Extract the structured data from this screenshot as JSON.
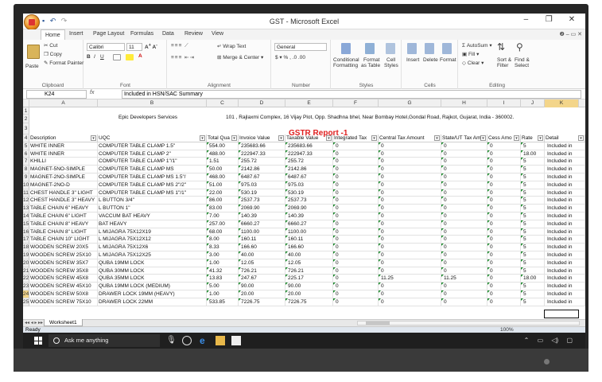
{
  "window": {
    "title": "GST - Microsoft Excel",
    "controls": [
      "–",
      "❐",
      "✕"
    ]
  },
  "ribbon": {
    "tabs": [
      "Home",
      "Insert",
      "Page Layout",
      "Formulas",
      "Data",
      "Review",
      "View"
    ],
    "help": "❷ – ▭ ✕",
    "clipboard": {
      "paste": "Paste",
      "cut": "Cut",
      "copy": "Copy",
      "format_painter": "Format Painter",
      "label": "Clipboard"
    },
    "font": {
      "name": "Calibri",
      "size": "11",
      "label": "Font"
    },
    "alignment": {
      "wrap": "Wrap Text",
      "merge": "Merge & Center",
      "label": "Alignment"
    },
    "number": {
      "format": "General",
      "label": "Number"
    },
    "styles": {
      "conditional": "Conditional",
      "conditional2": "Formatting",
      "format_table": "Format",
      "format_table2": "as Table",
      "cell_styles": "Cell",
      "cell_styles2": "Styles",
      "label": "Styles"
    },
    "cells": {
      "insert": "Insert",
      "delete": "Delete",
      "format": "Format",
      "label": "Cells"
    },
    "editing": {
      "autosum": "AutoSum",
      "fill": "Fill",
      "clear": "Clear",
      "sort": "Sort &",
      "sort2": "Filter",
      "find": "Find &",
      "find2": "Select",
      "label": "Editing"
    }
  },
  "formula_bar": {
    "name_box": "K24",
    "fx": "fx",
    "formula": "Included in HSN/SAC Summary"
  },
  "columns": [
    "A",
    "B",
    "C",
    "D",
    "E",
    "F",
    "G",
    "H",
    "I",
    "J",
    "K"
  ],
  "sheet": {
    "company": "Epic Developers Services",
    "address": "101 , Rajlaxmi Complex, 16 Vijay Plot, Opp. Shadhna bhel, Near Bombay Hotel,Gondal Road, Rajkot, Gujarat, India - 360002.",
    "report_title": "GSTR Report -1",
    "headers": [
      "Description",
      "UQC",
      "Total Qua",
      "Invoice Value",
      "Taxable Value",
      "Integrated Tax",
      "Central Tax Amount",
      "State/UT Tax Am",
      "Cess Amo",
      "Rate",
      "Detail"
    ],
    "row_numbers": [
      "1",
      "2",
      "3",
      "4",
      "5",
      "6",
      "7",
      "8",
      "9",
      "10",
      "11",
      "12",
      "13",
      "14",
      "15",
      "16",
      "17",
      "18",
      "19",
      "20",
      "21",
      "22",
      "23",
      "24",
      "25"
    ],
    "rows": [
      [
        "WHITE INNER",
        "COMPUTER TABLE CLAMP 1.5\"",
        "554.00",
        "235683.66",
        "235683.66",
        "0",
        "0",
        "0",
        "0",
        "5",
        "Included in"
      ],
      [
        "WHITE INNER",
        "COMPUTER TABLE CLAMP 2\"",
        "488.00",
        "222947.33",
        "222947.33",
        "0",
        "0",
        "0",
        "0",
        "18.00",
        "Included in"
      ],
      [
        "KHILLI",
        "COMPUTER TABLE CLAMP 1\"/1\"",
        "1.51",
        "255.72",
        "255.72",
        "0",
        "0",
        "0",
        "0",
        "5",
        "Included in"
      ],
      [
        "MAGNET-5NO-SIMPLE",
        "COMPUTER TABLE CLAMP MS",
        "50.00",
        "2142.86",
        "2142.86",
        "0",
        "0",
        "0",
        "0",
        "5",
        "Included in"
      ],
      [
        "MAGNET-2NO-SIMPLE",
        "COMPUTER TABLE CLAMP MS 1.5\"/",
        "468.00",
        "6487.67",
        "6487.67",
        "0",
        "0",
        "0",
        "0",
        "5",
        "Included in"
      ],
      [
        "MAGNET-2NO-D",
        "COMPUTER TABLE CLAMP MS 2\"/2\"",
        "51.00",
        "975.03",
        "975.03",
        "0",
        "0",
        "0",
        "0",
        "5",
        "Included in"
      ],
      [
        "CHEST HANDLE 3\" LIGHT",
        "COMPUTER TABLE CLAMP MS 1\"/1\"",
        "22.00",
        "530.19",
        "530.19",
        "0",
        "0",
        "0",
        "0",
        "5",
        "Included in"
      ],
      [
        "CHEST HANDLE 3\" HEAVY",
        "L BUTTON 3/4\"",
        "86.00",
        "2537.73",
        "2537.73",
        "0",
        "0",
        "0",
        "0",
        "5",
        "Included in"
      ],
      [
        "TABLE CHAIN 6\" HEAVY",
        "L BUTTON 1\"",
        "83.00",
        "2069.90",
        "2069.90",
        "0",
        "0",
        "0",
        "0",
        "5",
        "Included in"
      ],
      [
        "TABLE CHAIN 6\" LIGHT",
        "VACCUM BAT HEAVY",
        "7.00",
        "140.39",
        "140.39",
        "0",
        "0",
        "0",
        "0",
        "5",
        "Included in"
      ],
      [
        "TABLE CHAIN 8\" HEAVY",
        "BAT HEAVY",
        "257.00",
        "6660.27",
        "6660.27",
        "0",
        "0",
        "0",
        "0",
        "5",
        "Included in"
      ],
      [
        "TABLE CHAIN 8\" LIGHT",
        "L MIJAGRA 75X12X19",
        "68.00",
        "1100.00",
        "1100.00",
        "0",
        "0",
        "0",
        "0",
        "5",
        "Included in"
      ],
      [
        "TABLE CHAIN 10\" LIGHT",
        "L MIJAGRA 75X12X12",
        "8.00",
        "160.11",
        "160.11",
        "0",
        "0",
        "0",
        "0",
        "5",
        "Included in"
      ],
      [
        "WOODEN SCREW 20X5",
        "L MIJAGRA 75X12X6",
        "8.33",
        "166.60",
        "166.60",
        "0",
        "0",
        "0",
        "0",
        "5",
        "Included in"
      ],
      [
        "WOODEN SCREW 25X10",
        "L MIJAGRA 75X12X25",
        "3.00",
        "40.00",
        "40.00",
        "0",
        "0",
        "0",
        "0",
        "5",
        "Included in"
      ],
      [
        "WOODEN SCREW 35X7",
        "QUBA 19MM LOCK",
        "1.00",
        "12.05",
        "12.05",
        "0",
        "0",
        "0",
        "0",
        "5",
        "Included in"
      ],
      [
        "WOODEN SCREW 35X8",
        "QUBA 30MM LOCK",
        "41.32",
        "726.21",
        "726.21",
        "0",
        "0",
        "0",
        "0",
        "5",
        "Included in"
      ],
      [
        "WOODEN SCREW 45X8",
        "QUBA 35MM LOCK",
        "13.83",
        "247.67",
        "225.17",
        "0",
        "11.25",
        "11.25",
        "0",
        "18.00",
        "Included in"
      ],
      [
        "WOODEN SCREW 45X10",
        "QUBA 19MM LOCK (MEDIUM)",
        "5.00",
        "90.00",
        "90.00",
        "0",
        "0",
        "0",
        "0",
        "5",
        "Included in"
      ],
      [
        "WOODEN SCREW 50X8",
        "DRAWER LOCK 19MM (HEAVY)",
        "1.00",
        "20.00",
        "20.00",
        "0",
        "0",
        "0",
        "0",
        "5",
        "Included in"
      ],
      [
        "WOODEN SCREW 75X10",
        "DRAWER LOCK 22MM",
        "533.85",
        "7226.75",
        "7226.75",
        "0",
        "0",
        "0",
        "0",
        "5",
        "Included in"
      ]
    ]
  },
  "sheet_tabs": {
    "nav": "◂◂ ◂ ▸ ▸▸",
    "active": "Worksheet1"
  },
  "status": {
    "ready": "Ready",
    "zoom": "100%"
  },
  "taskbar": {
    "search": "Ask me anything"
  }
}
